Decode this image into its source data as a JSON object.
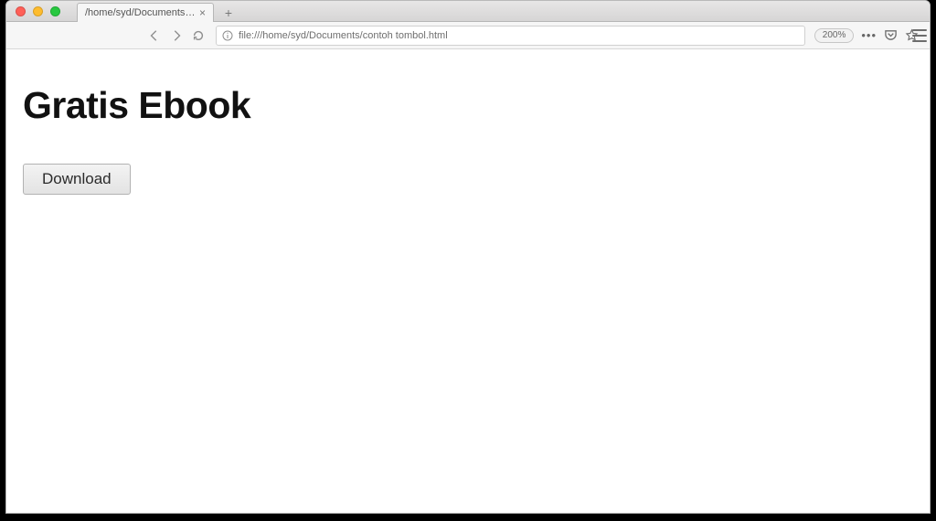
{
  "window": {
    "tab_title": "/home/syd/Documents/contoh",
    "url": "file:///home/syd/Documents/contoh tombol.html",
    "zoom_label": "200%"
  },
  "page": {
    "heading": "Gratis Ebook",
    "download_label": "Download"
  }
}
